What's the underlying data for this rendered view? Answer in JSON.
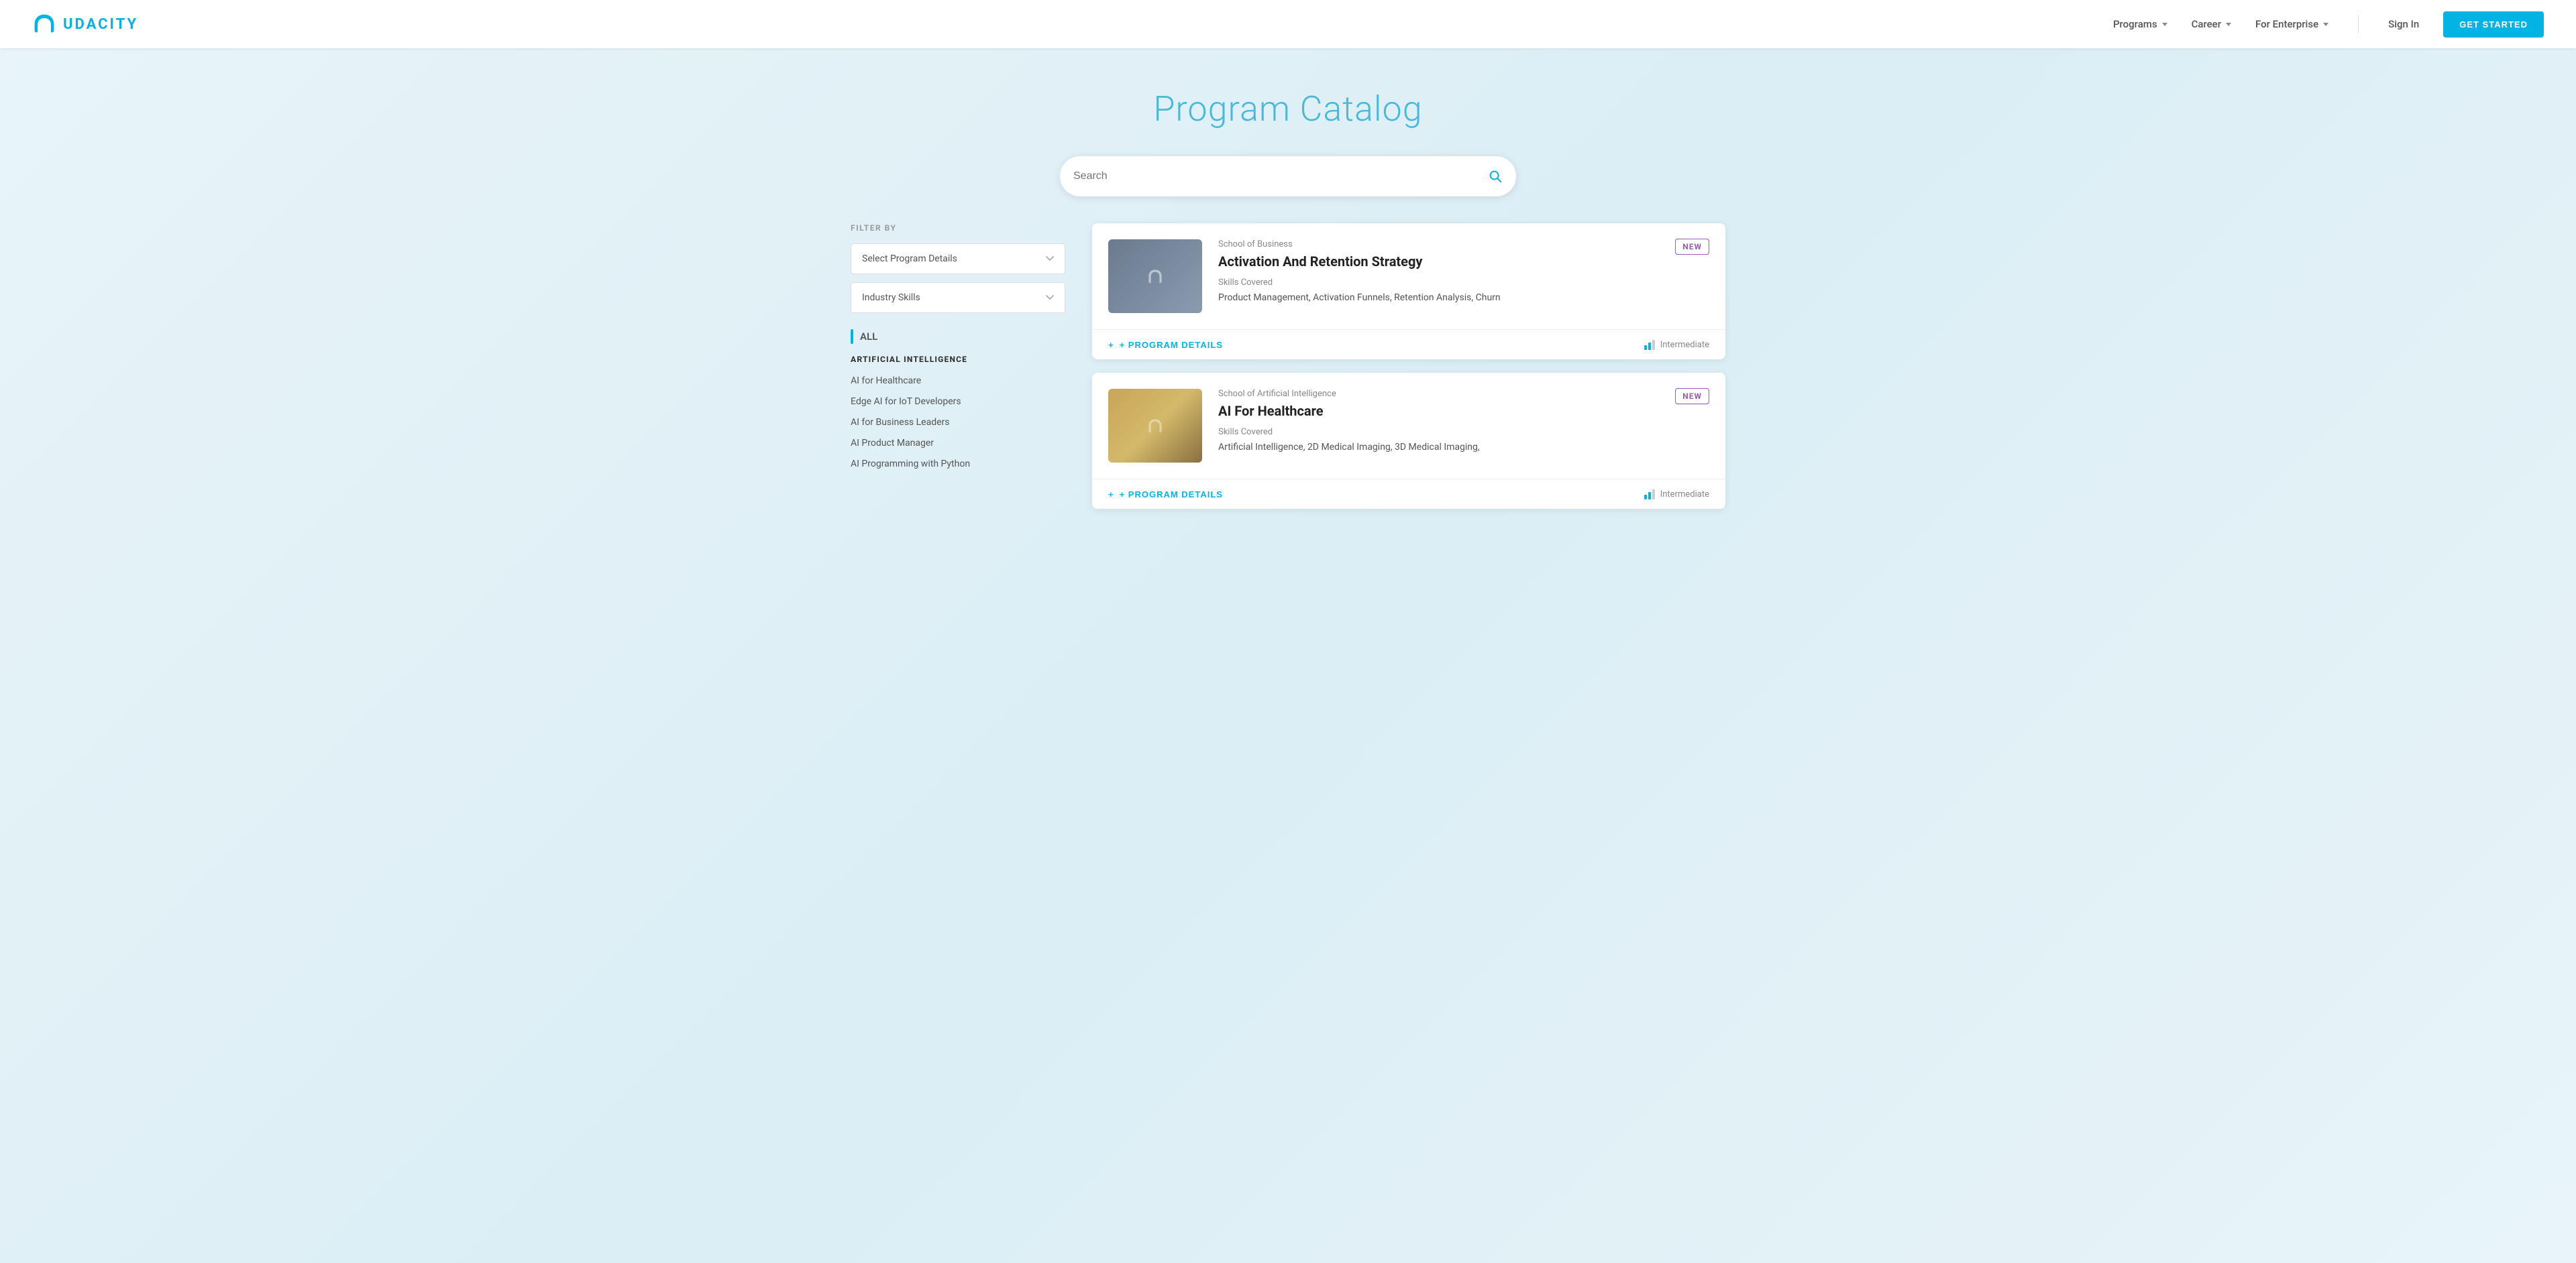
{
  "navbar": {
    "logo_text": "UDACITY",
    "nav_items": [
      {
        "label": "Programs",
        "has_chevron": true
      },
      {
        "label": "Career",
        "has_chevron": true
      },
      {
        "label": "For Enterprise",
        "has_chevron": true
      }
    ],
    "signin_label": "Sign In",
    "get_started_label": "GET STARTED"
  },
  "hero": {
    "title": "Program Catalog"
  },
  "search": {
    "placeholder": "Search"
  },
  "sidebar": {
    "filter_label": "FILTER BY",
    "filter_program": "Select Program Details",
    "filter_skills": "Industry Skills",
    "all_label": "ALL",
    "categories": [
      {
        "title": "ARTIFICIAL INTELLIGENCE",
        "items": [
          "AI for Healthcare",
          "Edge AI for IoT Developers",
          "AI for Business Leaders",
          "AI Product Manager",
          "AI Programming with Python"
        ]
      }
    ]
  },
  "programs": [
    {
      "school": "School of Business",
      "title": "Activation And Retention Strategy",
      "skills_label": "Skills Covered",
      "skills": "Product Management, Activation Funnels, Retention Analysis, Churn",
      "badge": "NEW",
      "level": "Intermediate",
      "level_filled": 2,
      "level_total": 3,
      "thumbnail_type": "business",
      "details_label": "+ PROGRAM DETAILS"
    },
    {
      "school": "School of Artificial Intelligence",
      "title": "AI For Healthcare",
      "skills_label": "Skills Covered",
      "skills": "Artificial Intelligence, 2D Medical Imaging, 3D Medical Imaging,",
      "badge": "NEW",
      "level": "Intermediate",
      "level_filled": 2,
      "level_total": 3,
      "thumbnail_type": "ai",
      "details_label": "+ PROGRAM DETAILS"
    }
  ]
}
